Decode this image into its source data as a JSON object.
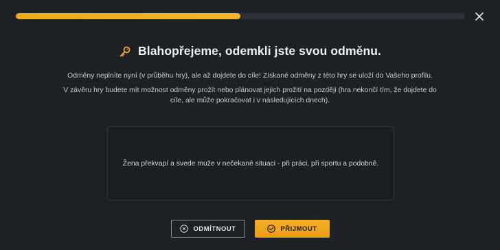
{
  "progress": {
    "fraction": 0.5
  },
  "colors": {
    "accent": "#F3A91E",
    "background": "#1D2024"
  },
  "icons": {
    "close": "close-icon",
    "key": "key-icon",
    "decline": "close-circle-icon",
    "accept": "check-circle-icon"
  },
  "dialog": {
    "title": "Blahopřejeme, odemkli jste svou odměnu.",
    "description_1": "Odměny neplníte nyní (v průběhu hry), ale až dojdete do cíle! Získané odměny z této hry se uloží do Vašeho profilu.",
    "description_2": "V závěru hry budete mít možnost odměny prožít nebo plánovat jejich prožití na později (hra nekončí tím, že dojdete do cíle, ale může pokračovat i v následujících dnech).",
    "reward_text": "Žena překvapí a svede muže v nečekané situaci - při práci, při sportu a podobně."
  },
  "buttons": {
    "decline_label": "ODMÍTNOUT",
    "accept_label": "PŘIJMOUT"
  }
}
